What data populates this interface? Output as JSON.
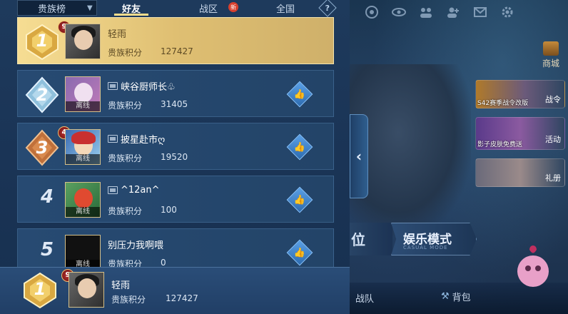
{
  "tabs": {
    "leaderboard_label": "贵族榜",
    "friends_label": "好友",
    "region_label": "战区",
    "region_badge": "新",
    "national_label": "全国",
    "help_label": "?"
  },
  "rows": [
    {
      "rank": "1",
      "level": "9",
      "name": "轻雨",
      "score_label": "贵族积分",
      "score": "127427",
      "status": ""
    },
    {
      "rank": "2",
      "level": "",
      "name": "峡谷厨师长♧",
      "score_label": "贵族积分",
      "score": "31405",
      "status": "离线"
    },
    {
      "rank": "3",
      "level": "4",
      "name": "披星赴市ღ",
      "score_label": "贵族积分",
      "score": "19520",
      "status": "离线"
    },
    {
      "rank": "4",
      "level": "",
      "name": "^12an^",
      "score_label": "贵族积分",
      "score": "100",
      "status": "离线"
    },
    {
      "rank": "5",
      "level": "",
      "name": "别压力我啊喂",
      "score_label": "贵族积分",
      "score": "0",
      "status": "离线"
    }
  ],
  "me": {
    "rank": "1",
    "level": "9",
    "name": "轻雨",
    "score_label": "贵族积分",
    "score": "127427"
  },
  "right": {
    "shop_label": "商城",
    "card1_caption": "S42赛季战令改版",
    "card1_side": "战令",
    "card2_caption": "影子皮肤免费送",
    "card2_side": "活动",
    "card3_side": "礼册",
    "rank_mode_label": "位",
    "mode_label": "娱乐模式",
    "mode_sub": "CASUAL MODE",
    "team_label": "战队",
    "bag_label": "背包"
  },
  "colors": {
    "gold": "#f3dc8c",
    "panel": "#1e3a5c",
    "like": "#3f86d0"
  }
}
